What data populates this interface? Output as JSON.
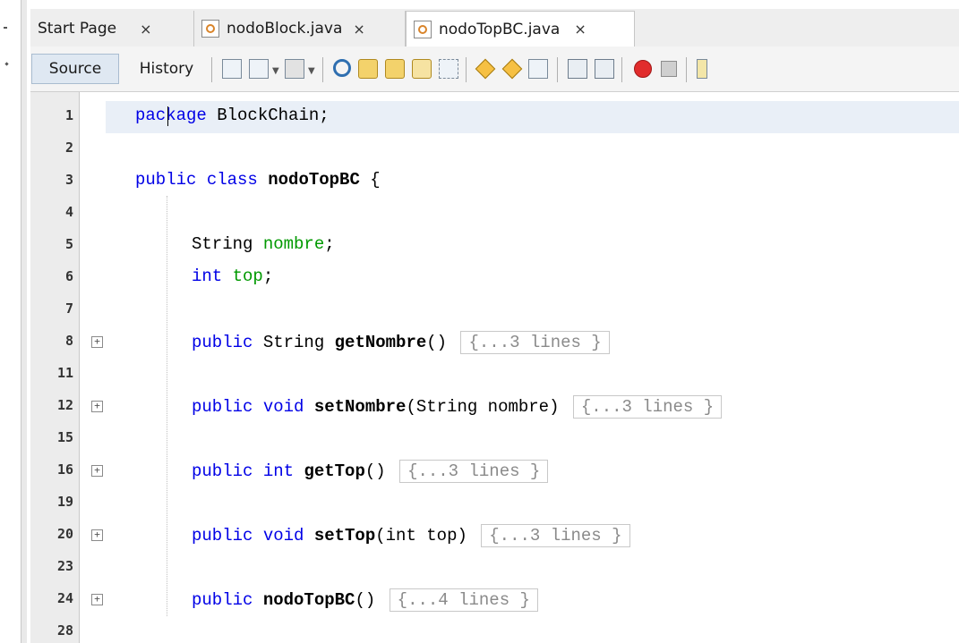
{
  "tabs": [
    {
      "label": "Start Page",
      "close": "×",
      "active": false
    },
    {
      "label": "nodoBlock.java",
      "close": "×",
      "active": false
    },
    {
      "label": "nodoTopBC.java",
      "close": "×",
      "active": true
    }
  ],
  "toolbar": {
    "source_label": "Source",
    "history_label": "History"
  },
  "editor": {
    "line_numbers": [
      "1",
      "2",
      "3",
      "4",
      "5",
      "6",
      "7",
      "8",
      "11",
      "12",
      "15",
      "16",
      "19",
      "20",
      "23",
      "24",
      "28"
    ],
    "fold_marker": "+",
    "code": {
      "l1_kw": "package",
      "l1_rest": " BlockChain;",
      "l3_kw": "public class",
      "l3_name": "nodoTopBC",
      "l3_brace": " {",
      "l5_type": "String",
      "l5_field": "nombre",
      "l5_semi": ";",
      "l6_type": "int",
      "l6_field": "top",
      "l6_semi": ";",
      "l8_kw": "public",
      "l8_type": " String ",
      "l8_name": "getNombre",
      "l8_params": "()",
      "l8_fold": "{...3 lines }",
      "l12_kw": "public void",
      "l12_name": "setNombre",
      "l12_params": "(String nombre)",
      "l12_fold": "{...3 lines }",
      "l16_kw": "public int",
      "l16_name": "getTop",
      "l16_params": "()",
      "l16_fold": "{...3 lines }",
      "l20_kw": "public void",
      "l20_name": "setTop",
      "l20_params": "(int top)",
      "l20_fold": "{...3 lines }",
      "l24_kw": "public",
      "l24_name": "nodoTopBC",
      "l24_params": "()",
      "l24_fold": "{...4 lines }"
    }
  },
  "colors": {
    "keyword": "#0000e6",
    "field": "#009900",
    "current_line": "#e9eff7"
  }
}
